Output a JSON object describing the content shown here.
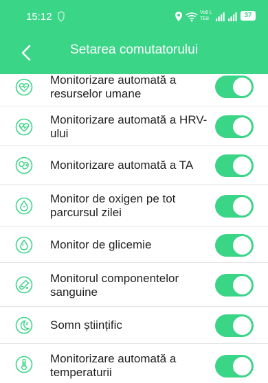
{
  "status_bar": {
    "time": "15:12",
    "network_label": "Vo8 LTE8",
    "battery_level": "37",
    "icons": [
      "location-icon",
      "wifi-icon",
      "signal-icon",
      "signal-icon",
      "battery-icon"
    ]
  },
  "header": {
    "title": "Setarea comutatorului",
    "back_icon": "chevron-left-icon"
  },
  "colors": {
    "accent": "#3bd588",
    "icon_tint": "#3bd588",
    "divider": "#e6e6e6",
    "text": "#222222"
  },
  "settings": [
    {
      "label": "Monitorizare automată a resurselor umane",
      "icon": "heart-rate-icon",
      "enabled": true
    },
    {
      "label": "Monitorizare automată a HRV-ului",
      "icon": "hrv-icon",
      "enabled": true
    },
    {
      "label": "Monitorizare automată a TA",
      "icon": "blood-pressure-icon",
      "enabled": true
    },
    {
      "label": "Monitor de oxigen pe tot parcursul zilei",
      "icon": "oxygen-drop-icon",
      "enabled": true
    },
    {
      "label": "Monitor de glicemie",
      "icon": "glucose-drop-icon",
      "enabled": true
    },
    {
      "label": "Monitorul componentelor sanguine",
      "icon": "blood-tube-icon",
      "enabled": true
    },
    {
      "label": "Somn științific",
      "icon": "moon-sleep-icon",
      "enabled": true
    },
    {
      "label": "Monitorizare automată a temperaturii",
      "icon": "thermometer-icon",
      "enabled": true
    }
  ]
}
